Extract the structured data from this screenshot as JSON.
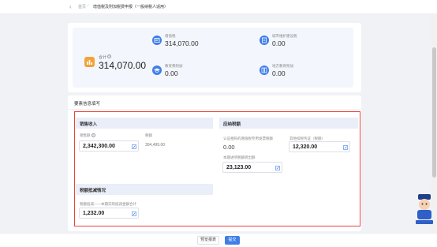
{
  "header": {
    "back_glyph": "‹",
    "breadcrumb_home": "首页",
    "breadcrumb_sep": "/",
    "breadcrumb_current": "增值税及附加税费申报（一般纳税人适用）"
  },
  "summary": {
    "total": {
      "label": "合计",
      "value": "314,070.00"
    },
    "metrics": [
      {
        "label": "增值税",
        "value": "314,070.00",
        "icon": "vat-document-icon"
      },
      {
        "label": "城市维护建设税",
        "value": "0.00",
        "icon": "building-icon"
      },
      {
        "label": "教育费附加",
        "value": "0.00",
        "icon": "graduation-cap-icon"
      },
      {
        "label": "地方教育附加",
        "value": "0.00",
        "icon": "book-icon"
      }
    ]
  },
  "basic_info": {
    "title": "要素信息填写",
    "sales_income": {
      "title": "销售收入",
      "sales_amount_label": "销售额",
      "sales_amount_value": "2,342,300.00",
      "tax_amount_label": "税额",
      "tax_amount_value": "304,499.00"
    },
    "tax_deduction": {
      "title": "应纳税额",
      "certified_label": "认证相符的增值税专用发票税额",
      "certified_value": "0.00",
      "other_label": "其他扣税凭证（税额）",
      "other_value": "12,320.00",
      "transfer_label": "本期进项税额转出额",
      "transfer_value": "23,123.00"
    },
    "tax_reduction": {
      "title": "税额抵减情况",
      "label": "税额抵减——本期实际抵减金额合计",
      "value": "1,232.00"
    }
  },
  "footer": {
    "prev_label": "预览报表",
    "submit_label": "提交"
  },
  "colors": {
    "accent": "#3f7ee8",
    "orange": "#f2a23a",
    "highlight_frame": "#e8453c"
  }
}
